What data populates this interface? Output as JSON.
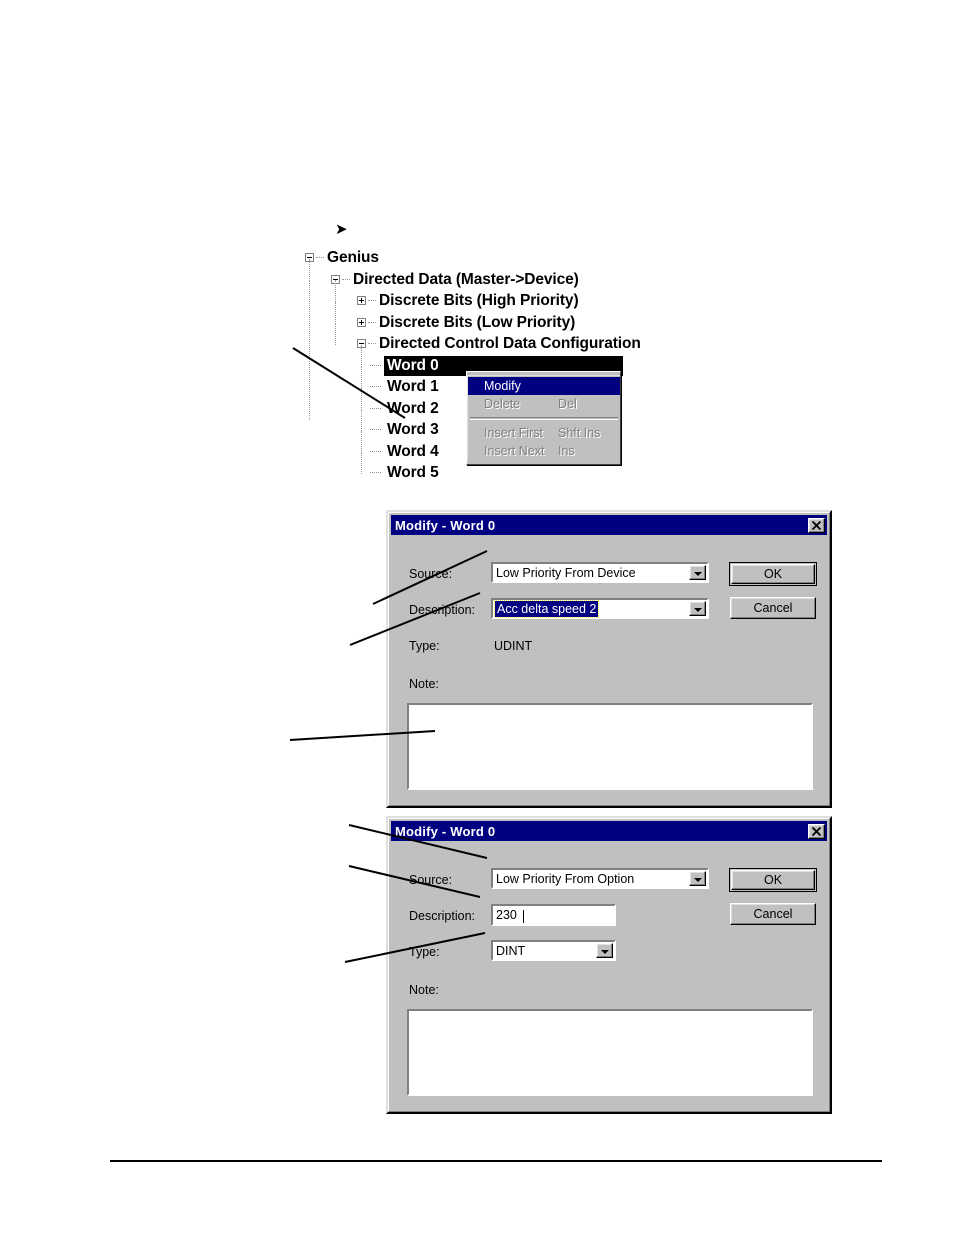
{
  "tree": {
    "bullet": "➤",
    "nodes": [
      {
        "label": "Genius",
        "indent": 0,
        "toggle": "minus"
      },
      {
        "label": "Directed Data (Master->Device)",
        "indent": 1,
        "toggle": "minus"
      },
      {
        "label": "Discrete Bits (High Priority)",
        "indent": 2,
        "toggle": "plus"
      },
      {
        "label": "Discrete Bits (Low Priority)",
        "indent": 2,
        "toggle": "plus"
      },
      {
        "label": "Directed Control Data Configuration",
        "indent": 2,
        "toggle": "minus"
      },
      {
        "label": "Word 0",
        "indent": 3,
        "toggle": "leaf",
        "selected": true
      },
      {
        "label": "Word 1",
        "indent": 3,
        "toggle": "leaf"
      },
      {
        "label": "Word 2",
        "indent": 3,
        "toggle": "leaf"
      },
      {
        "label": "Word 3",
        "indent": 3,
        "toggle": "leaf"
      },
      {
        "label": "Word 4",
        "indent": 3,
        "toggle": "leaf"
      },
      {
        "label": "Word 5",
        "indent": 3,
        "toggle": "leaf"
      }
    ]
  },
  "context_menu": {
    "items": [
      {
        "label": "Modify",
        "accel": "",
        "state": "highlighted",
        "mnemonic": "M"
      },
      {
        "label": "Delete",
        "accel": "Del",
        "state": "disabled",
        "mnemonic": "D"
      },
      {
        "separator": true
      },
      {
        "label": "Insert First",
        "accel": "Shft Ins",
        "state": "disabled",
        "mnemonic": "F"
      },
      {
        "label": "Insert Next",
        "accel": "Ins",
        "state": "disabled",
        "mnemonic": "x"
      }
    ]
  },
  "dialog1": {
    "title": "Modify - Word 0",
    "close_label": "close-icon",
    "source_label": "Source:",
    "source_value": "Low Priority From Device",
    "description_label": "Description:",
    "description_value": "Acc delta speed 2",
    "type_label": "Type:",
    "type_value": "UDINT",
    "note_label": "Note:",
    "note_value": "",
    "ok_label": "OK",
    "cancel_label": "Cancel"
  },
  "dialog2": {
    "title": "Modify - Word 0",
    "close_label": "close-icon",
    "source_label": "Source:",
    "source_value": "Low Priority From Option",
    "description_label": "Description:",
    "description_value": "230",
    "type_label": "Type:",
    "type_value": "DINT",
    "note_label": "Note:",
    "note_value": "",
    "ok_label": "OK",
    "cancel_label": "Cancel"
  },
  "colors": {
    "titlebar": "#000080",
    "dialog_face": "#c0c0c0",
    "selection": "#000080",
    "tree_selection": "#000000",
    "disabled_text": "#808080"
  }
}
